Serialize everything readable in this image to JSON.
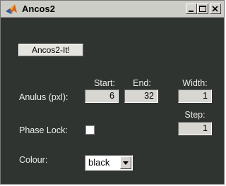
{
  "window": {
    "title": "Ancos2",
    "title_bar_color": "#cdcdc7",
    "panel_color": "#303431",
    "icon": "matlab-logo-icon",
    "controls": [
      "minimize-icon",
      "maximize-icon",
      "close-icon"
    ]
  },
  "actions": {
    "run_button_label": "Ancos2-It!"
  },
  "anulus": {
    "label": "Anulus (pxl):",
    "start_header": "Start:",
    "end_header": "End:",
    "width_header": "Width:",
    "start_value": "6",
    "end_value": "32",
    "width_value": "1"
  },
  "step": {
    "label": "Step:",
    "value": "1"
  },
  "phase_lock": {
    "label": "Phase Lock:",
    "checked": false
  },
  "colour": {
    "label": "Colour:",
    "selected": "black"
  }
}
